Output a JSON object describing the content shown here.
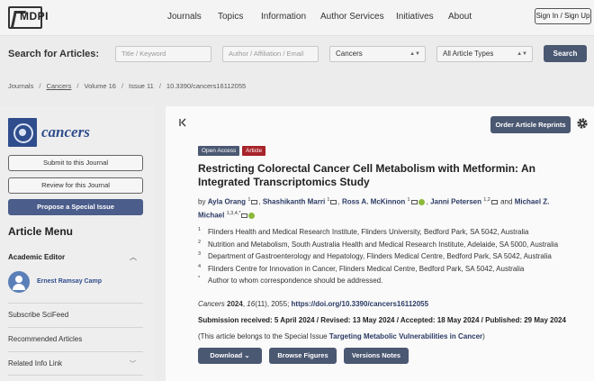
{
  "brand": {
    "logo_text": "MDPI"
  },
  "nav": {
    "items": [
      "Journals",
      "Topics",
      "Information",
      "Author Services",
      "Initiatives",
      "About"
    ],
    "sign_in": "Sign In / Sign Up"
  },
  "search": {
    "label": "Search for Articles:",
    "title_placeholder": "Title / Keyword",
    "author_placeholder": "Author / Affiliation / Email",
    "journal_value": "Cancers",
    "type_value": "All Article Types",
    "button": "Search"
  },
  "breadcrumb": [
    "Journals",
    "Cancers",
    "Volume 16",
    "Issue 11",
    "10.3390/cancers16112055"
  ],
  "sidebar": {
    "journal_name": "cancers",
    "submit": "Submit to this Journal",
    "review": "Review for this Journal",
    "propose": "Propose a Special Issue",
    "menu_title": "Article Menu",
    "editor_label": "Academic Editor",
    "editor_name": "Ernest Ramsay Camp",
    "links": [
      "Subscribe SciFeed",
      "Recommended Articles",
      "Related Info Link"
    ]
  },
  "article": {
    "reprints_button": "Order Article Reprints",
    "badges": {
      "open_access": "Open Access",
      "type": "Article"
    },
    "title": "Restricting Colorectal Cancer Cell Metabolism with Metformin: An Integrated Transcriptomics Study",
    "by": "by",
    "authors": [
      {
        "name": "Ayla Orang",
        "sup": "1"
      },
      {
        "name": "Shashikanth Marri",
        "sup": "1"
      },
      {
        "name": "Ross A. McKinnon",
        "sup": "1"
      },
      {
        "name": "Janni Petersen",
        "sup": "1,2"
      },
      {
        "name": "Michael Z. Michael",
        "sup": "1,3,4,*"
      }
    ],
    "and": "and",
    "affiliations": [
      {
        "n": "1",
        "text": "Flinders Health and Medical Research Institute, Flinders University, Bedford Park, SA 5042, Australia"
      },
      {
        "n": "2",
        "text": "Nutrition and Metabolism, South Australia Health and Medical Research Institute, Adelaide, SA 5000, Australia"
      },
      {
        "n": "3",
        "text": "Department of Gastroenterology and Hepatology, Flinders Medical Centre, Bedford Park, SA 5042, Australia"
      },
      {
        "n": "4",
        "text": "Flinders Centre for Innovation in Cancer, Flinders Medical Centre, Bedford Park, SA 5042, Australia"
      },
      {
        "n": "*",
        "text": "Author to whom correspondence should be addressed."
      }
    ],
    "citation": {
      "journal": "Cancers",
      "year": "2024",
      "volume": "16",
      "issue_pages": "(11), 2055;",
      "doi": "https://doi.org/10.3390/cancers16112055"
    },
    "dates": "Submission received: 5 April 2024 / Revised: 13 May 2024 / Accepted: 18 May 2024 / Published: 29 May 2024",
    "special_issue_prefix": "(This article belongs to the Special Issue",
    "special_issue_link": "Targeting Metabolic Vulnerabilities in Cancer",
    "special_issue_suffix": ")",
    "buttons": {
      "download": "Download",
      "figures": "Browse Figures",
      "versions": "Versions Notes"
    }
  }
}
